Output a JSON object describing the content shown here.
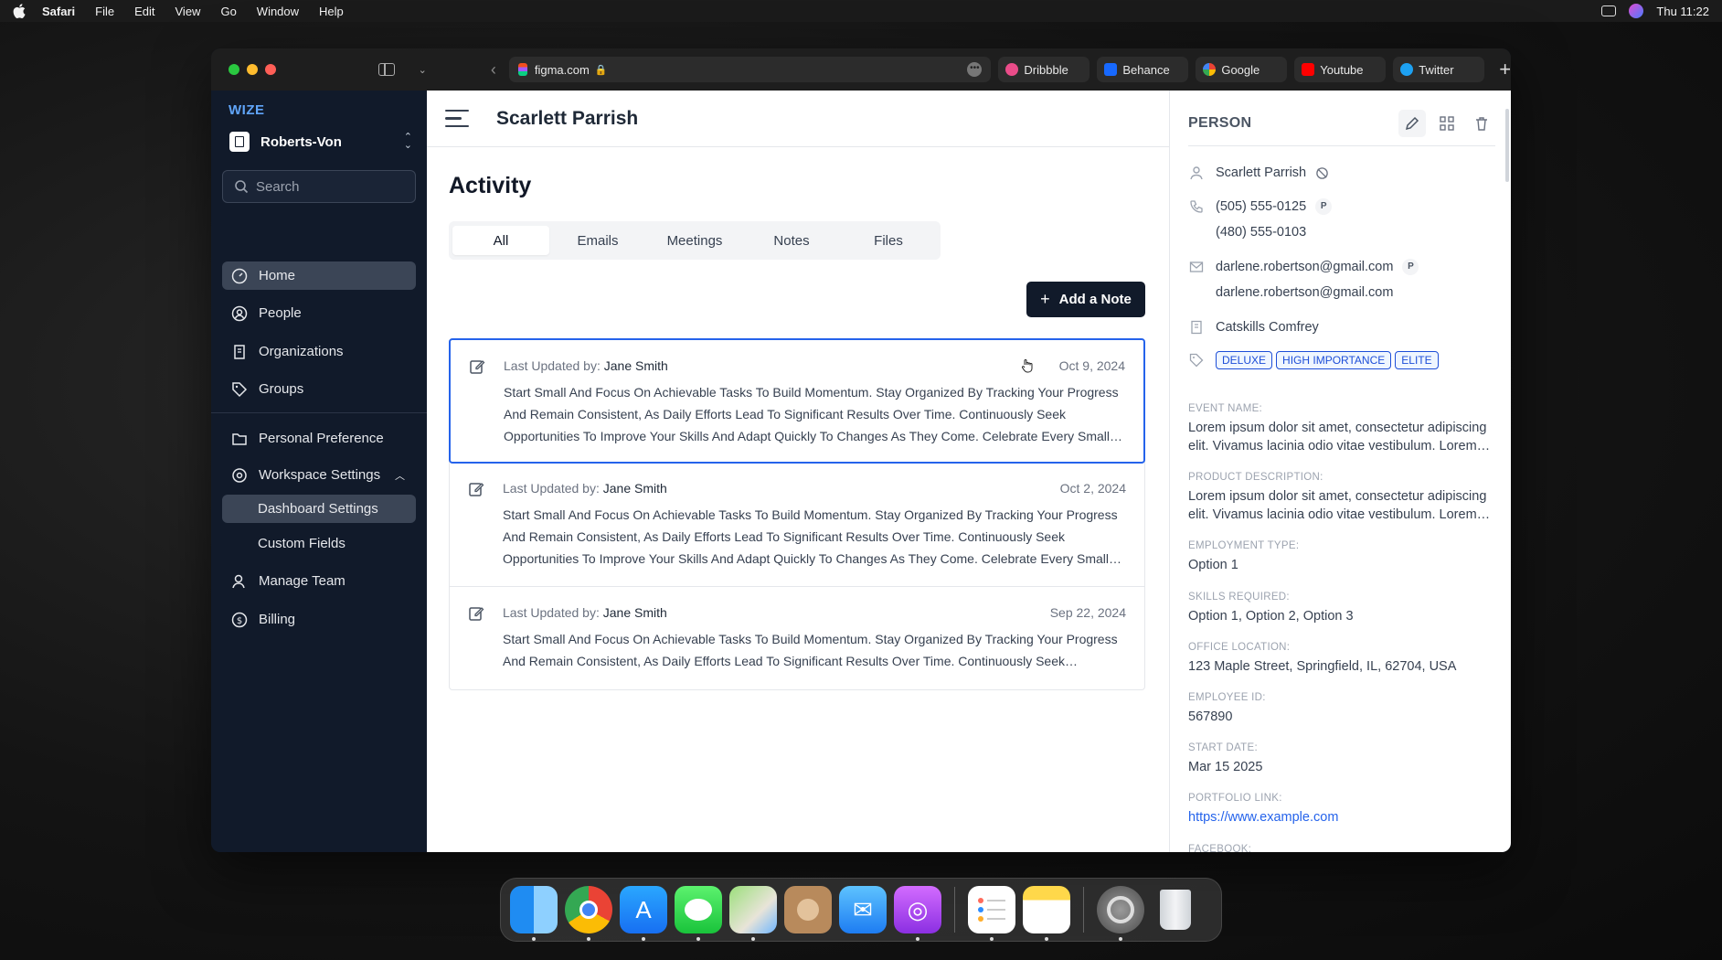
{
  "menubar": {
    "app": "Safari",
    "items": [
      "File",
      "Edit",
      "View",
      "Go",
      "Window",
      "Help"
    ],
    "clock": "Thu 11:22"
  },
  "browser": {
    "url": "figma.com",
    "favorites": [
      {
        "label": "Dribbble",
        "color": "#ea4c89"
      },
      {
        "label": "Behance",
        "color": "#1769ff"
      },
      {
        "label": "Google",
        "color": "#4285f4"
      },
      {
        "label": "Youtube",
        "color": "#ff0000"
      },
      {
        "label": "Twitter",
        "color": "#1da1f2"
      }
    ]
  },
  "sidebar": {
    "brand": "WIZE",
    "org_name": "Roberts-Von",
    "search_placeholder": "Search",
    "items": [
      {
        "label": "Home"
      },
      {
        "label": "People"
      },
      {
        "label": "Organizations"
      },
      {
        "label": "Groups"
      },
      {
        "label": "Personal Preference"
      },
      {
        "label": "Workspace Settings"
      },
      {
        "label": "Dashboard Settings"
      },
      {
        "label": "Custom Fields"
      },
      {
        "label": "Manage Team"
      },
      {
        "label": "Billing"
      }
    ]
  },
  "main": {
    "header_title": "Scarlett Parrish",
    "section_title": "Activity",
    "tabs": [
      {
        "label": "All"
      },
      {
        "label": "Emails"
      },
      {
        "label": "Meetings"
      },
      {
        "label": "Notes"
      },
      {
        "label": "Files"
      }
    ],
    "add_note_label": "Add a Note",
    "activities": [
      {
        "meta_prefix": "Last Updated by:",
        "author": "Jane Smith",
        "date": "Oct 9, 2024",
        "body": "Start Small And Focus On Achievable Tasks To Build Momentum. Stay Organized By Tracking Your Progress And Remain Consistent, As Daily Efforts Lead To Significant Results Over Time. Continuously Seek Opportunities To Improve Your Skills And Adapt Quickly To Changes As They Come. Celebrate Every Small Win Along The Way."
      },
      {
        "meta_prefix": "Last Updated by:",
        "author": "Jane Smith",
        "date": "Oct 2, 2024",
        "body": "Start Small And Focus On Achievable Tasks To Build Momentum. Stay Organized By Tracking Your Progress And Remain Consistent, As Daily Efforts Lead To Significant Results Over Time. Continuously Seek Opportunities To Improve Your Skills And Adapt Quickly To Changes As They Come. Celebrate Every Small Win Along The Way."
      },
      {
        "meta_prefix": "Last Updated by:",
        "author": "Jane Smith",
        "date": "Sep 22, 2024",
        "body": "Start Small And Focus On Achievable Tasks To Build Momentum. Stay Organized By Tracking Your Progress And Remain Consistent, As Daily Efforts Lead To Significant Results Over Time. Continuously Seek Opportunities To Improve Your Skills."
      }
    ]
  },
  "panel": {
    "title": "PERSON",
    "name": "Scarlett Parrish",
    "phones": [
      "(505) 555-0125",
      "(480) 555-0103"
    ],
    "emails": [
      "darlene.robertson@gmail.com",
      "darlene.robertson@gmail.com"
    ],
    "primary_badge": "P",
    "organization": "Catskills Comfrey",
    "tags": [
      "DELUXE",
      "HIGH IMPORTANCE",
      "ELITE"
    ],
    "fields": [
      {
        "label": "EVENT NAME:",
        "value": "Lorem ipsum dolor sit amet, consectetur adipiscing elit. Vivamus lacinia odio vitae vestibulum. Lorem ipsum dolor sit amet."
      },
      {
        "label": "PRODUCT DESCRIPTION:",
        "value": "Lorem ipsum dolor sit amet, consectetur adipiscing elit. Vivamus lacinia odio vitae vestibulum. Lorem ipsum dolor sit amet."
      },
      {
        "label": "EMPLOYMENT TYPE:",
        "value": "Option 1"
      },
      {
        "label": "SKILLS REQUIRED:",
        "value": "Option 1, Option 2, Option 3"
      },
      {
        "label": "OFFICE LOCATION:",
        "value": "123 Maple Street, Springfield, IL, 62704, USA"
      },
      {
        "label": "EMPLOYEE ID:",
        "value": "567890"
      },
      {
        "label": "START DATE:",
        "value": "Mar 15 2025"
      },
      {
        "label": "PORTFOLIO LINK:",
        "value": "https://www.example.com"
      },
      {
        "label": "FACEBOOK:",
        "value": ""
      }
    ]
  }
}
